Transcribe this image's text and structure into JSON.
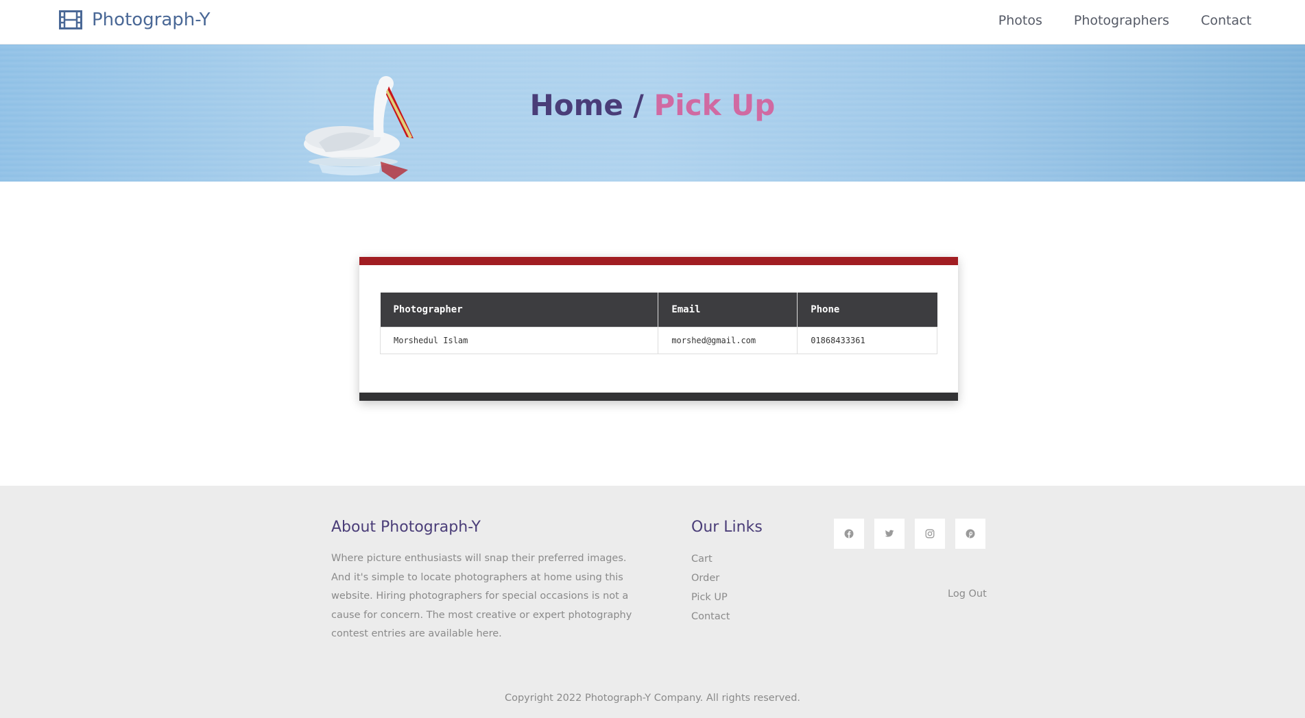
{
  "brand": {
    "name": "Photograph-Y",
    "icon": "film-icon"
  },
  "nav": {
    "items": [
      {
        "label": "Photos"
      },
      {
        "label": "Photographers"
      },
      {
        "label": "Contact"
      }
    ]
  },
  "hero": {
    "home": "Home",
    "separator": "/",
    "current": "Pick Up"
  },
  "table": {
    "headers": [
      "Photographer",
      "Email",
      "Phone"
    ],
    "rows": [
      {
        "photographer": "Morshedul Islam",
        "email": "morshed@gmail.com",
        "phone": "01868433361"
      }
    ]
  },
  "footer": {
    "about": {
      "title": "About Photograph-Y",
      "text": "Where picture enthusiasts will snap their preferred images. And it's simple to locate photographers at home using this website. Hiring photographers for special occasions is not a cause for concern. The most creative or expert photography contest entries are available here."
    },
    "links": {
      "title": "Our Links",
      "items": [
        {
          "label": "Cart"
        },
        {
          "label": "Order"
        },
        {
          "label": "Pick UP"
        },
        {
          "label": "Contact"
        }
      ]
    },
    "socials": [
      {
        "icon": "facebook-icon"
      },
      {
        "icon": "twitter-icon"
      },
      {
        "icon": "instagram-icon"
      },
      {
        "icon": "pinterest-icon"
      }
    ],
    "logout": "Log Out",
    "copyright": "Copyright 2022 Photograph-Y Company. All rights reserved."
  },
  "colors": {
    "brand": "#4a6896",
    "heading": "#4a3d78",
    "accent": "#d06aa2",
    "card_top": "#a11d22",
    "table_header": "#3d3d40"
  }
}
